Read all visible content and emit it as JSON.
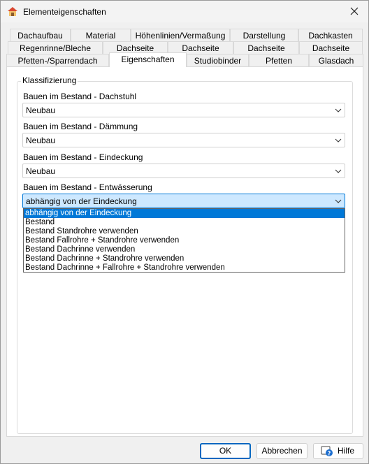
{
  "window": {
    "title": "Elementeigenschaften"
  },
  "tabs": {
    "row1": [
      "Dachaufbau",
      "Material",
      "Höhenlinien/Vermaßung",
      "Darstellung",
      "Dachkasten"
    ],
    "row2": [
      "Regenrinne/Bleche",
      "Dachseite",
      "Dachseite",
      "Dachseite",
      "Dachseite"
    ],
    "row3": [
      "Pfetten-/Sparrendach",
      "Eigenschaften",
      "Studiobinder",
      "Pfetten",
      "Glasdach"
    ]
  },
  "group": {
    "label": "Klassifizierung"
  },
  "fields": [
    {
      "label": "Bauen im Bestand - Dachstuhl",
      "value": "Neubau"
    },
    {
      "label": "Bauen im Bestand - Dämmung",
      "value": "Neubau"
    },
    {
      "label": "Bauen im Bestand - Eindeckung",
      "value": "Neubau"
    },
    {
      "label": "Bauen im Bestand - Entwässerung",
      "value": "abhängig von der Eindeckung"
    }
  ],
  "dropdown": {
    "options": [
      "abhängig von der Eindeckung",
      "Bestand",
      "Bestand Standrohre verwenden",
      "Bestand Fallrohre + Standrohre verwenden",
      "Bestand Dachrinne verwenden",
      "Bestand Dachrinne + Standrohre verwenden",
      "Bestand Dachrinne + Fallrohre + Standrohre verwenden"
    ],
    "selected_index": 0
  },
  "buttons": {
    "ok": "OK",
    "cancel": "Abbrechen",
    "help": "Hilfe"
  },
  "colors": {
    "accent": "#0078d7",
    "focus_fill": "#cde8ff"
  },
  "icons": {
    "app": "roof-app-icon",
    "close": "close-icon",
    "chevron": "chevron-down-icon",
    "help": "help-icon"
  }
}
